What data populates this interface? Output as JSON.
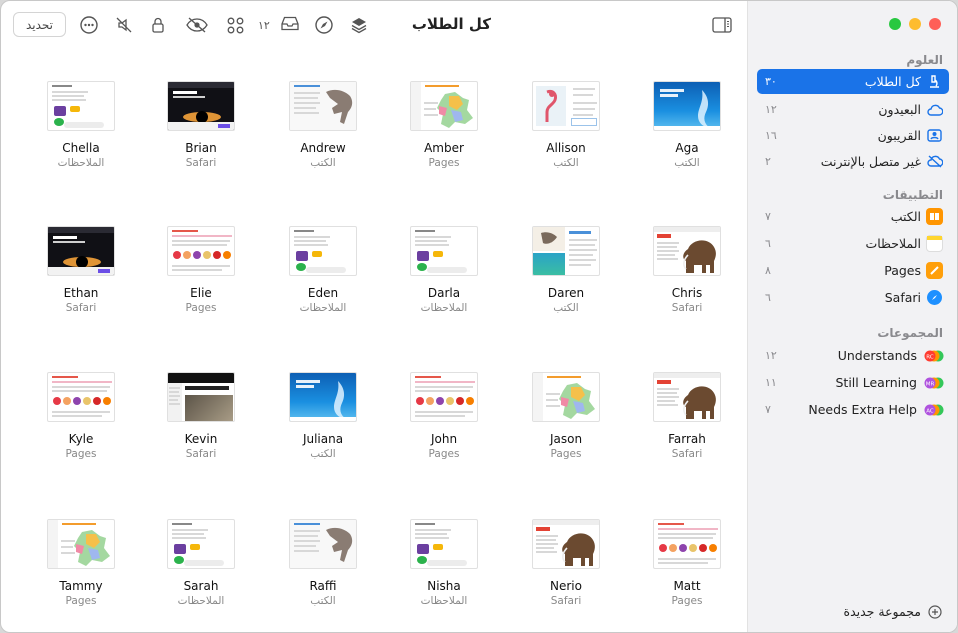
{
  "window": {
    "title": "كل الطلاب",
    "refresh_label": "تحديد",
    "inbox_count": "١٢"
  },
  "colors": {
    "accent": "#1a73e8",
    "close": "#ff5f57",
    "minimize": "#febc2e",
    "zoom": "#28c840"
  },
  "toolbar_icons": [
    "ellipsis-circle-icon",
    "mute-icon",
    "lock-icon",
    "eye-slash-icon",
    "apps-grid-icon",
    "inbox-icon",
    "compass-icon",
    "layers-icon",
    "sidebar-toggle-icon"
  ],
  "sidebar": {
    "section_classes": "العلوم",
    "classes": [
      {
        "label": "كل الطلاب",
        "count": "٣٠",
        "icon": "microscope-icon",
        "selected": true
      },
      {
        "label": "البعيدون",
        "count": "١٢",
        "icon": "cloud-icon"
      },
      {
        "label": "القريبون",
        "count": "١٦",
        "icon": "person-card-icon"
      },
      {
        "label": "غير متصل بالإنترنت",
        "count": "٢",
        "icon": "cloud-slash-icon"
      }
    ],
    "section_apps": "التطبيقات",
    "apps": [
      {
        "label": "الكتب",
        "count": "٧",
        "icon": "books-icon"
      },
      {
        "label": "الملاحظات",
        "count": "٦",
        "icon": "notes-icon"
      },
      {
        "label": "Pages",
        "count": "٨",
        "icon": "pages-icon"
      },
      {
        "label": "Safari",
        "count": "٦",
        "icon": "safari-icon"
      }
    ],
    "section_groups": "المجموعات",
    "groups": [
      {
        "label": "Understands",
        "count": "١٢",
        "badge": "RC"
      },
      {
        "label": "Still Learning",
        "count": "١١",
        "badge": "MR"
      },
      {
        "label": "Needs Extra Help",
        "count": "٧",
        "badge": "AC"
      }
    ],
    "new_group_label": "مجموعة جديدة"
  },
  "students": [
    {
      "name": "Aga",
      "app": "الكتب",
      "thumb": "whale"
    },
    {
      "name": "Allison",
      "app": "الكتب",
      "thumb": "flamingo"
    },
    {
      "name": "Amber",
      "app": "Pages",
      "thumb": "map"
    },
    {
      "name": "Andrew",
      "app": "الكتب",
      "thumb": "dino"
    },
    {
      "name": "Brian",
      "app": "Safari",
      "thumb": "blackhole"
    },
    {
      "name": "Chella",
      "app": "الملاحظات",
      "thumb": "notes"
    },
    {
      "name": "Chris",
      "app": "Safari",
      "thumb": "mammoth"
    },
    {
      "name": "Daren",
      "app": "الكتب",
      "thumb": "fish"
    },
    {
      "name": "Darla",
      "app": "الملاحظات",
      "thumb": "notes"
    },
    {
      "name": "Eden",
      "app": "الملاحظات",
      "thumb": "notes"
    },
    {
      "name": "Elie",
      "app": "Pages",
      "thumb": "fruit"
    },
    {
      "name": "Ethan",
      "app": "Safari",
      "thumb": "blackhole"
    },
    {
      "name": "Farrah",
      "app": "Safari",
      "thumb": "mammoth"
    },
    {
      "name": "Jason",
      "app": "Pages",
      "thumb": "map"
    },
    {
      "name": "John",
      "app": "Pages",
      "thumb": "fruit"
    },
    {
      "name": "Juliana",
      "app": "الكتب",
      "thumb": "whale"
    },
    {
      "name": "Kevin",
      "app": "Safari",
      "thumb": "article"
    },
    {
      "name": "Kyle",
      "app": "Pages",
      "thumb": "fruit"
    },
    {
      "name": "Matt",
      "app": "Pages",
      "thumb": "fruit"
    },
    {
      "name": "Nerio",
      "app": "Safari",
      "thumb": "mammoth"
    },
    {
      "name": "Nisha",
      "app": "الملاحظات",
      "thumb": "notes"
    },
    {
      "name": "Raffi",
      "app": "الكتب",
      "thumb": "dino"
    },
    {
      "name": "Sarah",
      "app": "الملاحظات",
      "thumb": "notes"
    },
    {
      "name": "Tammy",
      "app": "Pages",
      "thumb": "map"
    }
  ]
}
